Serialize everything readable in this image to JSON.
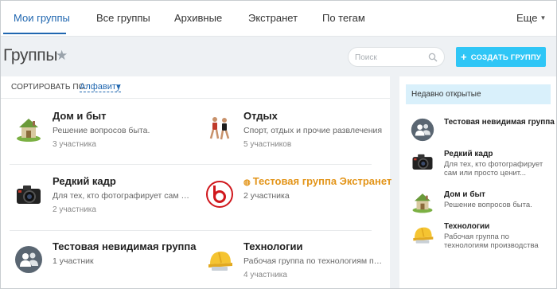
{
  "nav": {
    "tabs": [
      {
        "label": "Мои группы",
        "active": true
      },
      {
        "label": "Все группы",
        "active": false
      },
      {
        "label": "Архивные",
        "active": false
      },
      {
        "label": "Экстранет",
        "active": false
      },
      {
        "label": "По тегам",
        "active": false
      }
    ],
    "more_label": "Еще",
    "accent_color": "#2067b0"
  },
  "header": {
    "title": "Группы",
    "search_placeholder": "Поиск",
    "create_button_label": "СОЗДАТЬ ГРУППУ",
    "create_button_color": "#2fc6f6"
  },
  "sort": {
    "label": "СОРТИРОВАТЬ ПО:",
    "value": "Алфавиту"
  },
  "groups": [
    {
      "name": "Дом и быт",
      "description": "Решение вопросов быта.",
      "members": "3 участника",
      "icon": "house-icon"
    },
    {
      "name": "Отдых",
      "description": "Спорт, отдых и прочие развлечения",
      "members": "5 участников",
      "icon": "runners-icon"
    },
    {
      "name": "Редкий кадр",
      "description": "Для тех, кто фотографирует сам или просто ценит",
      "members": "2 участника",
      "icon": "camera-icon"
    },
    {
      "name": "Тестовая группа Экстранет",
      "description": "",
      "members": "2 участника",
      "icon": "extranet-logo-icon",
      "extranet": true
    },
    {
      "name": "Тестовая невидимая группа",
      "description": "",
      "members": "1 участник",
      "icon": "group-users-icon"
    },
    {
      "name": "Технологии",
      "description": "Рабочая группа по технологиям производства",
      "members": "4 участника",
      "icon": "helmet-icon"
    }
  ],
  "recent": {
    "title": "Недавно открытые",
    "items": [
      {
        "name": "Тестовая невидимая группа",
        "description": "",
        "icon": "group-users-icon"
      },
      {
        "name": "Редкий кадр",
        "description": "Для тех, кто фотографирует сам или просто ценит...",
        "icon": "camera-icon"
      },
      {
        "name": "Дом и быт",
        "description": "Решение вопросов быта.",
        "icon": "house-icon"
      },
      {
        "name": "Технологии",
        "description": "Рабочая группа по технологиям производства",
        "icon": "helmet-icon"
      }
    ]
  },
  "colors": {
    "extranet": "#e3951a",
    "recent_header_bg": "#d9f0fb"
  }
}
